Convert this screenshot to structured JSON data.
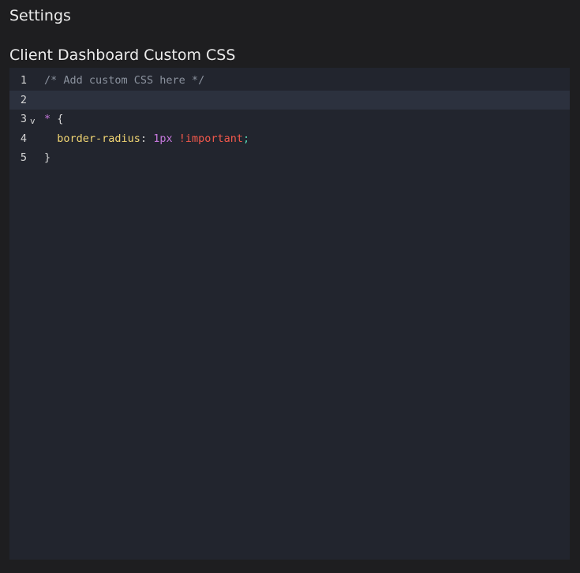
{
  "page": {
    "title": "Settings"
  },
  "section": {
    "title": "Client Dashboard Custom CSS"
  },
  "editor": {
    "active_line": 2,
    "fold_icon": "chevron-down-icon",
    "fold_glyph": "v",
    "lines": [
      {
        "number": "1",
        "comment": "/* Add custom CSS here */"
      },
      {
        "number": "2"
      },
      {
        "number": "3",
        "selector": "*",
        "brace": "{"
      },
      {
        "number": "4",
        "indent": "  ",
        "property": "border-radius",
        "colon": ": ",
        "value_number": "1px",
        "space": " ",
        "important": "!important",
        "semicolon": ";"
      },
      {
        "number": "5",
        "brace": "}"
      }
    ],
    "colors": {
      "background": "#22252e",
      "active_line": "#2c313e",
      "comment": "#8b929e",
      "selector": "#c678dd",
      "property": "#f1d573",
      "number": "#c678dd",
      "important": "#f1584b",
      "semicolon": "#56d4b4"
    }
  }
}
